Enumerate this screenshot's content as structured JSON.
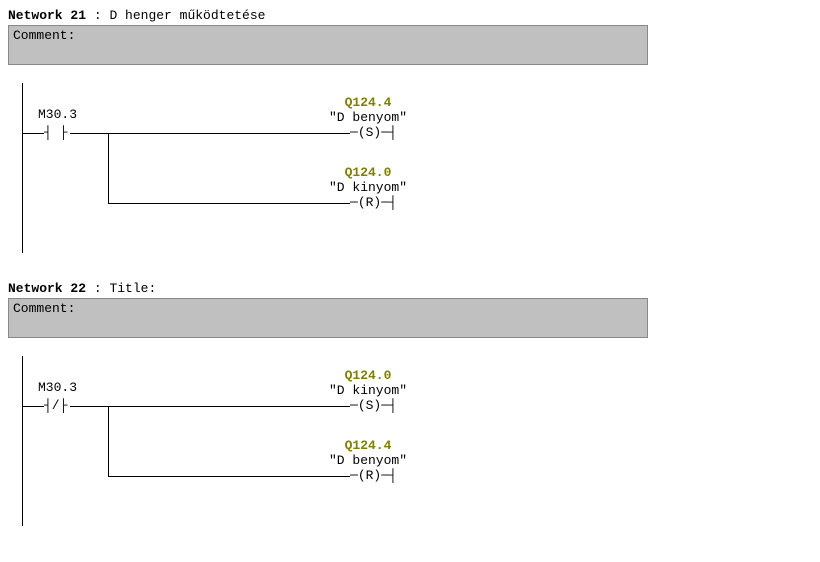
{
  "networks": [
    {
      "id": "n21",
      "label": "Network 21",
      "title": "D henger működtetése",
      "comment_label": "Comment:",
      "rung": {
        "contact_addr": "M30.3",
        "contact_glyph": "┤ ├",
        "branch1": {
          "addr": "Q124.4",
          "name": "\"D benyom\"",
          "coil": "(S)"
        },
        "branch2": {
          "addr": "Q124.0",
          "name": "\"D kinyom\"",
          "coil": "(R)"
        }
      }
    },
    {
      "id": "n22",
      "label": "Network 22",
      "title": "Title:",
      "comment_label": "Comment:",
      "rung": {
        "contact_addr": "M30.3",
        "contact_glyph": "┤/├",
        "branch1": {
          "addr": "Q124.0",
          "name": "\"D kinyom\"",
          "coil": "(S)"
        },
        "branch2": {
          "addr": "Q124.4",
          "name": "\"D benyom\"",
          "coil": "(R)"
        }
      }
    }
  ]
}
